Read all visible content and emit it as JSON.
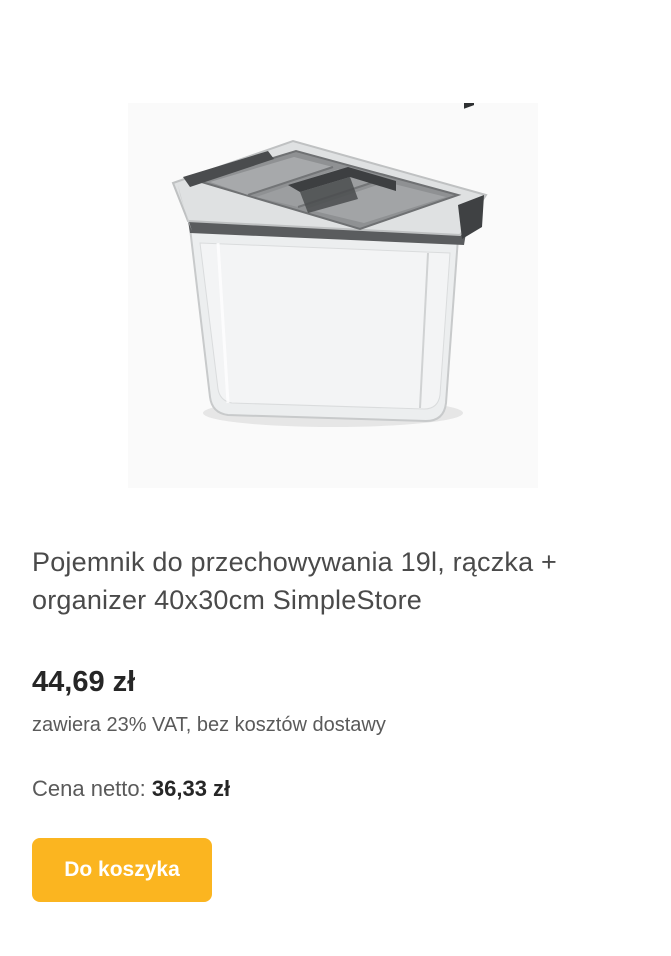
{
  "product": {
    "image_alt": "product-container-photo",
    "title": "Pojemnik do przechowywania 19l, rączka + organizer 40x30cm SimpleStore",
    "price_gross": "44,69 zł",
    "vat_note": "zawiera 23% VAT, bez kosztów dostawy",
    "net_label": "Cena netto:",
    "net_value": "36,33 zł",
    "cart_button_label": "Do koszyka"
  },
  "colors": {
    "button_bg": "#fbb520",
    "button_text": "#ffffff",
    "title_text": "#4a4a4a",
    "price_text": "#262626"
  }
}
